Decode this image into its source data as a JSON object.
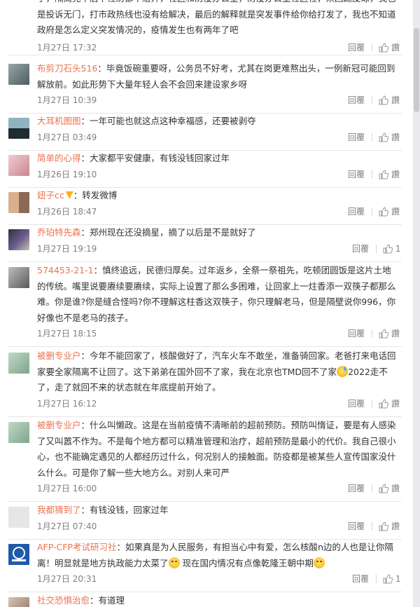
{
  "comments": [
    {
      "user": "",
      "text_html": "子，隔离完毕后下社防都不给开，社区和防疫办公室，防疫办公室社区社，来回踢皮球，我也是投诉无门，打市政热线也没有给解决，最后的解释就是突发事件给你给打发了，我也不知道政府是怎么定义突发情况的，疫情发生也有两年了吧",
      "time": "1月27日 17:32",
      "reply": "回覆",
      "like": "讚"
    },
    {
      "user": "布剪刀石头516",
      "text_html": "毕竟饭碗重要呀，公务员不好考，尤其在岗更难熬出头，一例新冠可能回到解放前。如此形势下大量年轻人会不会回来建设家乡呀",
      "time": "1月27日 10:39",
      "reply": "回覆",
      "like": "讚"
    },
    {
      "user": "大耳机图图",
      "text_html": "一年可能也就这点这种幸福感，还要被剥夺",
      "time": "1月27日 03:49",
      "reply": "回覆",
      "like": "讚"
    },
    {
      "user": "简单的心得",
      "text_html": "大家都平安健康，有钱没钱回家过年",
      "time": "1月26日 19:10",
      "reply": "回覆",
      "like": "讚"
    },
    {
      "user": "妞子cc",
      "text_html": "转发微博",
      "time": "1月26日 18:47",
      "reply": "回覆",
      "like": "讚"
    },
    {
      "user": "乔珀特先森",
      "text_html": "郑州现在还没摘星，摘了以后是不是就好了",
      "time": "1月27日 19:19",
      "reply": "回覆",
      "like": "1"
    },
    {
      "user": "574453-21-1",
      "text_html": "慎终追远，民德归厚矣。过年返乡，全祭一祭祖先，吃顿团圆饭是这片土地的传统。嘴里说要赓续要赓续，实际上设置了那么多困难，让回家上一炷香添一双筷子都那么难。你是谁?你是缝合怪吗?你不理解这柱香这双筷子，你只理解老马，但是隔壁说你996，你好像也不是老马的孩子。",
      "time": "1月27日 18:15",
      "reply": "回覆",
      "like": "讚"
    },
    {
      "user": "被删专业户",
      "text_a": "今年不能回家了，核酸做好了，汽车火车不敢坐，准备骑回家。老爸打来电话回家要全家隔离不让回了。这下弟弟在国外回不了家，我在北京也TMD回不了家",
      "text_b": "2022走不了，走了就回不来的状态就在年底提前开始了。",
      "time": "1月27日 16:12",
      "reply": "回覆",
      "like": "讚"
    },
    {
      "user": "被删专业户",
      "text_html": "什么叫懒政。这是在当前疫情不清晰前的超前预防。预防叫惰证，要是有人感染了又叫嚣不作为。不是每个地方都可以精准管理和治疗，超前预防是最小的代价。我自己很小心，也不能确定遇见的人都经历过什么，何况别人的接触面。防疫都是被某些人宣传国家没什么什么。可是你了解一些大地方么。对别人来可严",
      "time": "1月27日 16:00",
      "reply": "回覆",
      "like": "讚"
    },
    {
      "user": "我都猜到了",
      "text_html": "有钱没钱，回家过年",
      "time": "1月27日 07:40",
      "reply": "回覆",
      "like": "讚"
    },
    {
      "user": "AFP-CFP考试研习社",
      "text_a": "如果真是为人民服务，有担当心中有爱，怎么核酸n边的人也是让你隔离！明显就是地方执政能力太菜了",
      "text_b": "现在国内情况有点像乾隆王朝中期",
      "time": "1月27日 20:31",
      "reply": "回覆",
      "like": "1"
    },
    {
      "user": "社交恐惧治愈",
      "text_html": "有道理",
      "time": "",
      "reply": "",
      "like": ""
    }
  ],
  "colors": {
    "username": "#eb7350",
    "meta": "#808080",
    "text": "#333333"
  }
}
